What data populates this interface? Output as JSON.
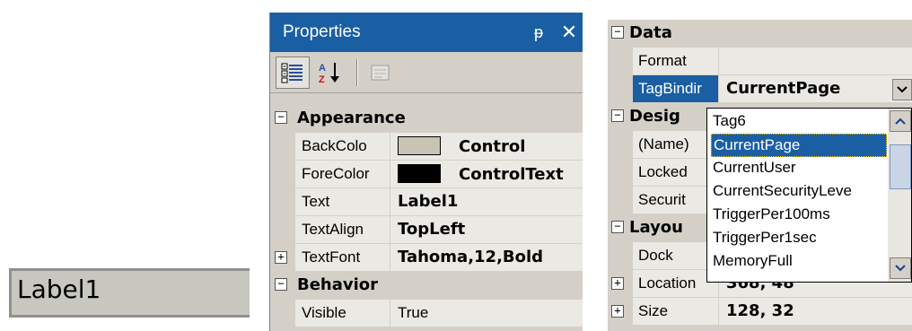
{
  "label_preview": {
    "text": "Label1"
  },
  "properties_panel": {
    "title": "Properties",
    "pin_glyph": "ᵽ",
    "close_glyph": "✕",
    "categories": [
      {
        "name": "Appearance",
        "expander": "−",
        "rows": [
          {
            "name": "BackColo",
            "value": "Control",
            "swatch": "#c8c4b4"
          },
          {
            "name": "ForeColor",
            "value": "ControlText",
            "swatch": "#000000"
          },
          {
            "name": "Text",
            "value": "Label1"
          },
          {
            "name": "TextAlign",
            "value": "TopLeft"
          },
          {
            "name": "TextFont",
            "value": "Tahoma,12,Bold",
            "expander": "+"
          }
        ]
      },
      {
        "name": "Behavior",
        "expander": "−",
        "rows": [
          {
            "name": "Visible",
            "value": "True"
          }
        ]
      }
    ]
  },
  "data_panel": {
    "categories": [
      {
        "name": "Data",
        "expander": "−"
      },
      {
        "name": "Desig",
        "expander": "−"
      },
      {
        "name": "Layou",
        "expander": "−"
      }
    ],
    "rows": {
      "format": {
        "name": "Format",
        "value": ""
      },
      "tagbinding": {
        "name": "TagBindir",
        "value": "CurrentPage"
      },
      "name": {
        "name": "(Name)"
      },
      "locked": {
        "name": "Locked"
      },
      "security": {
        "name": "Securit"
      },
      "dock": {
        "name": "Dock"
      },
      "location": {
        "name": "Location",
        "value": "368, 48",
        "expander": "+"
      },
      "size": {
        "name": "Size",
        "value": "128, 32",
        "expander": "+"
      }
    }
  },
  "dropdown": {
    "options": [
      "Tag6",
      "CurrentPage",
      "CurrentUser",
      "CurrentSecurityLeve",
      "TriggerPer100ms",
      "TriggerPer1sec",
      "MemoryFull"
    ],
    "selected": "CurrentPage"
  },
  "colors": {
    "titlebar": "#1a5ea4",
    "panel": "#d4d0c8",
    "grid": "#ebe9e4",
    "selection": "#1a5ea4"
  }
}
